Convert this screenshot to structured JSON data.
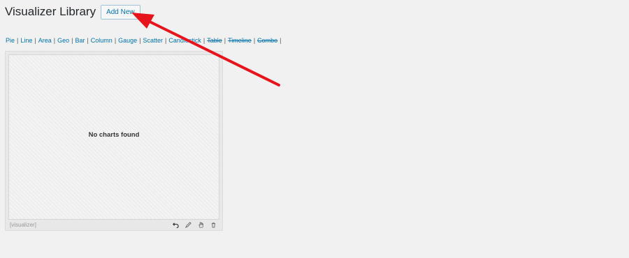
{
  "header": {
    "title": "Visualizer Library",
    "add_new_label": "Add New"
  },
  "filters": [
    {
      "label": "Pie",
      "disabled": false
    },
    {
      "label": "Line",
      "disabled": false
    },
    {
      "label": "Area",
      "disabled": false
    },
    {
      "label": "Geo",
      "disabled": false
    },
    {
      "label": "Bar",
      "disabled": false
    },
    {
      "label": "Column",
      "disabled": false
    },
    {
      "label": "Gauge",
      "disabled": false
    },
    {
      "label": "Scatter",
      "disabled": false
    },
    {
      "label": "Candlestick",
      "disabled": false
    },
    {
      "label": "Table",
      "disabled": true
    },
    {
      "label": "Timeline",
      "disabled": true
    },
    {
      "label": "Combo",
      "disabled": true
    }
  ],
  "filter_separator": "|",
  "card": {
    "empty_message": "No charts found",
    "shortcode": "[visualizer]",
    "actions": [
      "undo-icon",
      "pencil-icon",
      "hand-icon",
      "trash-icon"
    ]
  },
  "colors": {
    "link": "#0073aa",
    "annotation_arrow": "#e8141c",
    "background": "#f1f1f1"
  }
}
